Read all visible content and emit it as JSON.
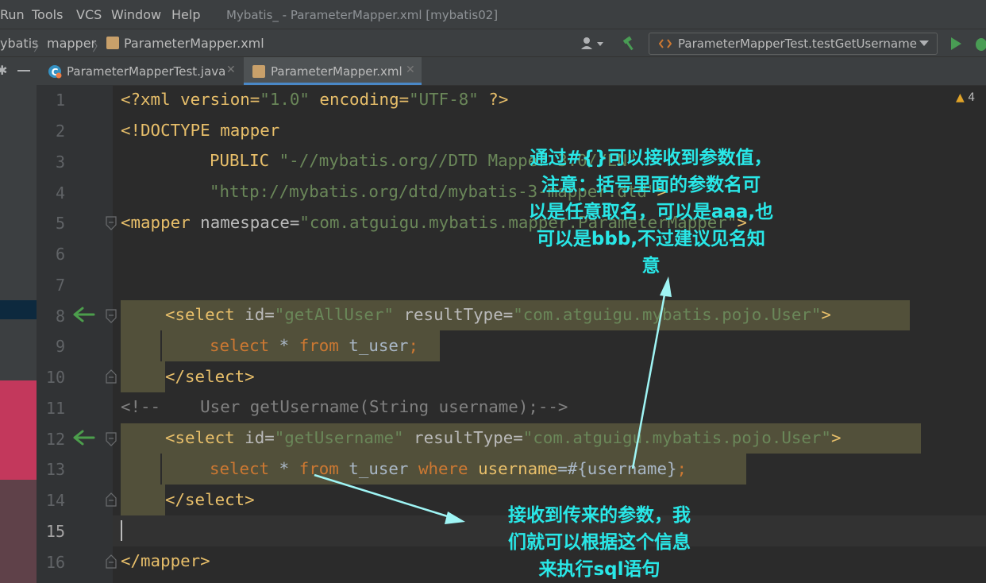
{
  "menu": {
    "run": "Run",
    "tools": "Tools",
    "vcs": "VCS",
    "window": "Window",
    "help": "Help"
  },
  "window_title": "Mybatis_ - ParameterMapper.xml [mybatis02]",
  "breadcrumb": {
    "item1": "ybatis",
    "item2": "mapper",
    "item3": "ParameterMapper.xml"
  },
  "run_config": "ParameterMapperTest.testGetUsername",
  "tabs": [
    {
      "label": "ParameterMapperTest.java"
    },
    {
      "label": "ParameterMapper.xml"
    }
  ],
  "warnings": "4",
  "line_numbers": [
    "1",
    "2",
    "3",
    "4",
    "5",
    "6",
    "7",
    "8",
    "9",
    "10",
    "11",
    "12",
    "13",
    "14",
    "15",
    "16"
  ],
  "code": {
    "l1": {
      "a": "<?xml version=",
      "b": "\"1.0\"",
      "c": " encoding=",
      "d": "\"UTF-8\"",
      "e": " ?>"
    },
    "l2": {
      "a": "<!DOCTYPE mapper"
    },
    "l3": {
      "a": "PUBLIC ",
      "b": "\"-//mybatis.org//DTD Mapper 3.0//EN\""
    },
    "l4": {
      "a": "\"http://mybatis.org/dtd/mybatis-3-mapper.dtd\"",
      "b": ">"
    },
    "l5": {
      "a": "<mapper ",
      "b": "namespace",
      "c": "=",
      "d": "\"com.atguigu.mybatis.mapper.ParameterMapper\"",
      "e": ">"
    },
    "l8": {
      "a": "<select ",
      "b": "id",
      "c": "=",
      "d": "\"getAllUser\"",
      "e": " resultType",
      "f": "=",
      "g": "\"com.atguigu.mybatis.pojo.User\"",
      "h": ">"
    },
    "l9": {
      "a": "select",
      "b": " * ",
      "c": "from",
      "d": " t_user",
      ";": ";"
    },
    "l10": {
      "a": "</select>"
    },
    "l11": {
      "a": "<!--    User getUsername(String username);-->"
    },
    "l12": {
      "a": "<select ",
      "b": "id",
      "c": "=",
      "d": "\"getUsername\"",
      "e": " resultType",
      "f": "=",
      "g": "\"com.atguigu.mybatis.pojo.User\"",
      "h": ">"
    },
    "l13": {
      "a": "select",
      "b": " * ",
      "c": "from",
      "d": " t_user ",
      "e": "where",
      "f": " username",
      "g": "=#{username}",
      "h": ";"
    },
    "l14": {
      "a": "</select>"
    },
    "l16": {
      "a": "</mapper>"
    }
  },
  "annotations": {
    "top": [
      "通过#{}可以接收到参数值，",
      "注意：括号里面的参数名可",
      "以是任意取名，可以是aaa,也",
      "可以是bbb,不过建议见名知",
      "意"
    ],
    "bottom": [
      "接收到传来的参数，我",
      "们就可以根据这个信息",
      "来执行sql语句"
    ]
  },
  "colors": {
    "tag": "#e8bf6a",
    "attr": "#bababa",
    "string": "#6a8759",
    "keyword": "#cc7832",
    "text": "#a9b7c6",
    "comment": "#808080",
    "accent": "#29e7e7",
    "highlight": "#52503a"
  },
  "icons": [
    "user-icon",
    "hammer-icon",
    "run-icon",
    "debug-icon",
    "gear-icon",
    "minimize-icon",
    "java-class-icon",
    "xml-file-icon",
    "close-icon",
    "warning-icon",
    "override-arrow-icon",
    "fold-icon",
    "xml-icon"
  ]
}
